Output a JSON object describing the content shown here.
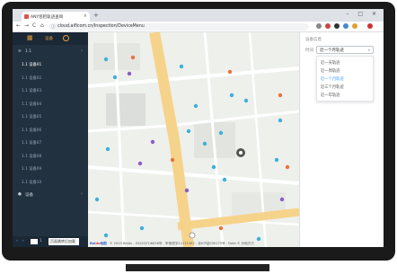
{
  "browser": {
    "tab_title": "ANY巡检轨迹查询",
    "new_tab": "+",
    "window_controls": "–  □  ✕",
    "url": "cloud.aiflcom.cn/Inspection/DeviceMenu",
    "nav": {
      "back": "←",
      "forward": "→",
      "reload": "C",
      "home": "⌂"
    },
    "extensions": [
      "#888888",
      "#cc4444",
      "#333333",
      "#4488cc",
      "#e0a030",
      "#cc3333"
    ]
  },
  "sidebar": {
    "top_label": "设备",
    "group1": {
      "label": "1.1",
      "chevron": "›"
    },
    "items": [
      "1.1 设备01",
      "1.1 设备02",
      "1.1 设备03",
      "1.1 设备04",
      "1.1 设备05",
      "1.1 设备06",
      "1.1 设备07",
      "1.1 设备08",
      "1.1 设备09",
      "1.1 设备10"
    ],
    "group2": {
      "label": "设备",
      "chevron": "›"
    },
    "pager": {
      "prev": "‹",
      "next": "›",
      "page": "1",
      "button": "页面跳转后加载"
    }
  },
  "map": {
    "footer_logo_a": "Bai",
    "footer_logo_b": "du",
    "footer_logo_c": "地图",
    "footer_text": "© 2023 Baidu - GS(2021)6026号 - 甲测资字11111342 - 京ICP证030173号 - Data © 长地万方"
  },
  "panel": {
    "title": "设备信息",
    "label": "时间",
    "selected": "近一个月轨迹",
    "caret": "▾",
    "options": [
      "近一天轨迹",
      "近一周轨迹",
      "近一个月轨迹",
      "近三个月轨迹",
      "近一年轨迹"
    ],
    "selected_index": 2
  },
  "colors": {
    "sidebar_bg": "#223140",
    "accent": "#e8a23a",
    "road": "#f6d38a",
    "select_blue": "#409eff"
  }
}
